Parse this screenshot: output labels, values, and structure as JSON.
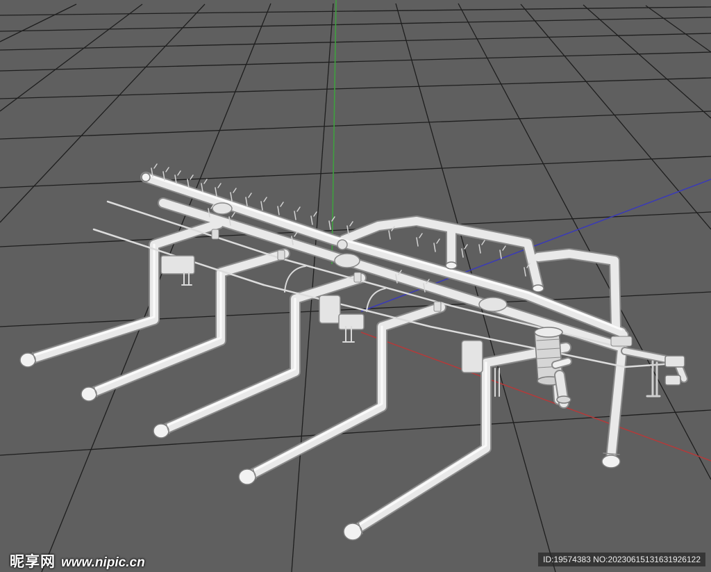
{
  "viewport": {
    "background_color": "#5f5f5f",
    "grid_color": "#1c1c1c",
    "axis_colors": {
      "x": "#b43a3a",
      "y": "#3fa03f",
      "z": "#3a3ab8"
    },
    "model_color": "#e9e9e9"
  },
  "watermark": {
    "brand": "昵享网",
    "url": "www.nipic.cn",
    "id_text": "ID:19574383 NO:20230615131631926122"
  }
}
